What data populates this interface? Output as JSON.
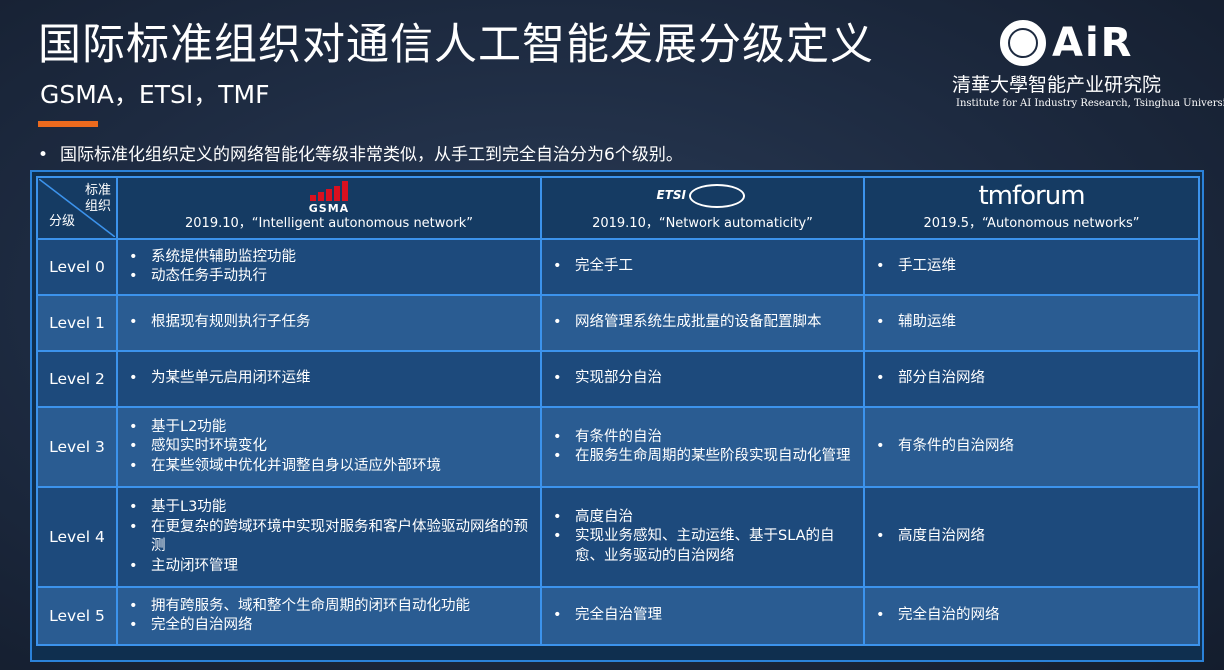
{
  "header": {
    "title": "国际标准组织对通信人工智能发展分级定义",
    "subtitle": "GSMA，ETSI，TMF",
    "bullet": "国际标准化组织定义的网络智能化等级非常类似，从手工到完全自治分为6个级别。"
  },
  "logo": {
    "brand": "AiR",
    "org_cn": "清華大學智能产业研究院",
    "org_en": "Institute for AI Industry Research, Tsinghua University"
  },
  "table": {
    "corner_top": "标准组织",
    "corner_bottom": "分级",
    "orgs": [
      {
        "logo": "GSMA",
        "ref": "2019.10，“Intelligent  autonomous network”"
      },
      {
        "logo": "ETSI",
        "ref": "2019.10，“Network automaticity”"
      },
      {
        "logo": "tmforum",
        "ref": "2019.5，“Autonomous networks”"
      }
    ],
    "rows": [
      {
        "level": "Level 0",
        "gsma": [
          "系统提供辅助监控功能",
          "动态任务手动执行"
        ],
        "etsi": [
          "完全手工"
        ],
        "tmf": [
          "手工运维"
        ]
      },
      {
        "level": "Level 1",
        "gsma": [
          "根据现有规则执行子任务"
        ],
        "etsi": [
          "网络管理系统生成批量的设备配置脚本"
        ],
        "tmf": [
          "辅助运维"
        ]
      },
      {
        "level": "Level 2",
        "gsma": [
          "为某些单元启用闭环运维"
        ],
        "etsi": [
          "实现部分自治"
        ],
        "tmf": [
          "部分自治网络"
        ]
      },
      {
        "level": "Level 3",
        "gsma": [
          "基于L2功能",
          "感知实时环境变化",
          "在某些领域中优化并调整自身以适应外部环境"
        ],
        "etsi": [
          "有条件的自治",
          "在服务生命周期的某些阶段实现自动化管理"
        ],
        "tmf": [
          "有条件的自治网络"
        ]
      },
      {
        "level": "Level 4",
        "gsma": [
          "基于L3功能",
          "在更复杂的跨域环境中实现对服务和客户体验驱动网络的预测",
          "主动闭环管理"
        ],
        "etsi": [
          "高度自治",
          "实现业务感知、主动运维、基于SLA的自愈、业务驱动的自治网络"
        ],
        "tmf": [
          "高度自治网络"
        ]
      },
      {
        "level": "Level 5",
        "gsma": [
          "拥有跨服务、域和整个生命周期的闭环自动化功能",
          "完全的自治网络"
        ],
        "etsi": [
          "完全自治管理"
        ],
        "tmf": [
          "完全自治的网络"
        ]
      }
    ]
  },
  "colors": {
    "accent": "#ec6a1e",
    "gsma_red": "#d9101f",
    "grid": "#3c93ec"
  }
}
